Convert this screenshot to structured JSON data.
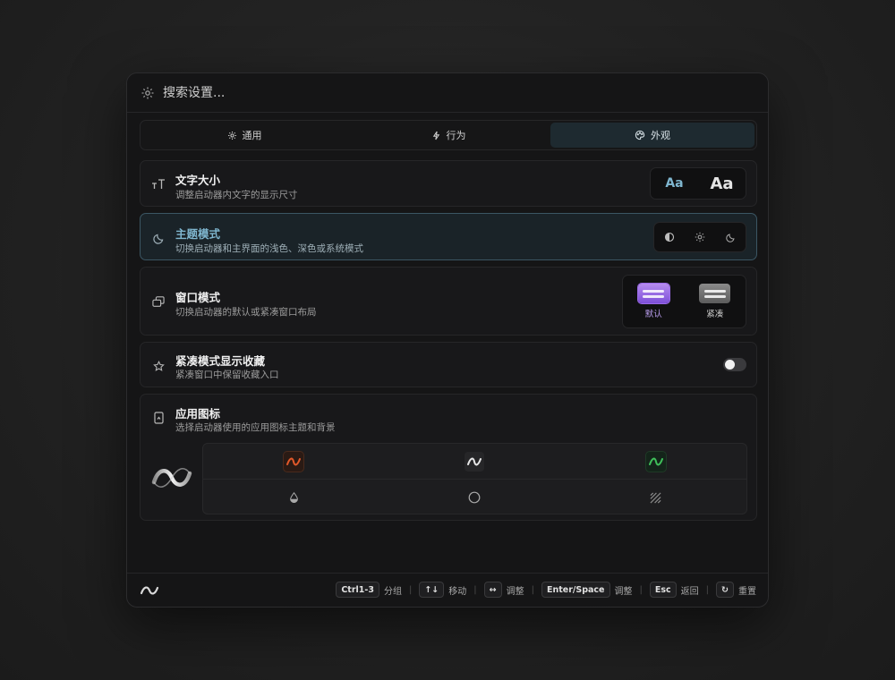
{
  "search": {
    "placeholder": "搜索设置..."
  },
  "tabs": [
    {
      "label": "通用",
      "icon": "gear-icon"
    },
    {
      "label": "行为",
      "icon": "bolt-icon"
    },
    {
      "label": "外观",
      "icon": "palette-icon",
      "active": true
    }
  ],
  "settings": {
    "font_size": {
      "title": "文字大小",
      "desc": "调整启动器内文字的显示尺寸",
      "small": "Aa",
      "large": "Aa"
    },
    "theme_mode": {
      "title": "主题模式",
      "desc": "切换启动器和主界面的浅色、深色或系统模式"
    },
    "window_mode": {
      "title": "窗口模式",
      "desc": "切换启动器的默认或紧凑窗口布局",
      "opt_default": "默认",
      "opt_compact": "紧凑"
    },
    "compact_favorites": {
      "title": "紧凑模式显示收藏",
      "desc": "紧凑窗口中保留收藏入口",
      "enabled": false
    },
    "app_icon": {
      "title": "应用图标",
      "desc": "选择启动器使用的应用图标主题和背景"
    }
  },
  "colors": {
    "accent": "#7fb6cf",
    "purple": "#9a6ae8",
    "orange": "#e0582a",
    "green": "#3fbf5a"
  },
  "footer": {
    "hints": [
      {
        "key": "Ctrl1-3",
        "label": "分组"
      },
      {
        "key": "↑↓",
        "label": "移动"
      },
      {
        "key": "↔",
        "label": "调整"
      },
      {
        "key": "Enter/Space",
        "label": "调整"
      },
      {
        "key": "Esc",
        "label": "返回"
      },
      {
        "key": "↻",
        "label": "重置"
      }
    ]
  }
}
